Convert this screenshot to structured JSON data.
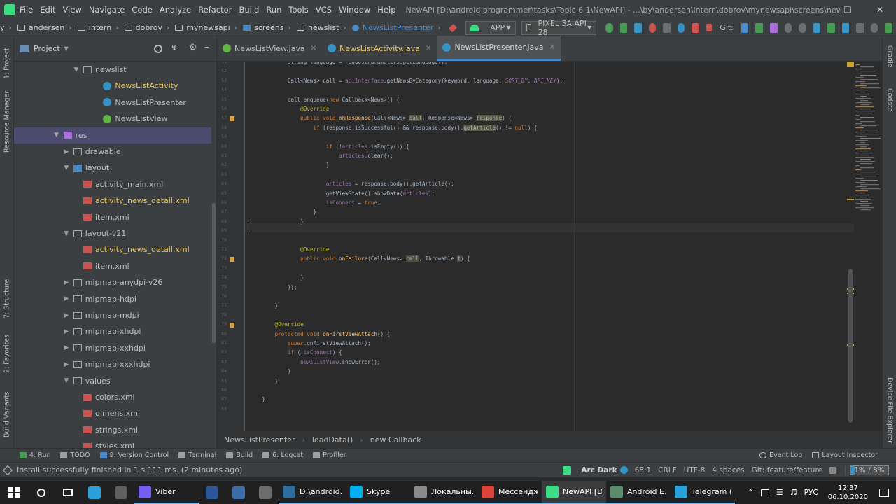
{
  "menubar": {
    "menus": [
      "File",
      "Edit",
      "View",
      "Navigate",
      "Code",
      "Analyze",
      "Refactor",
      "Build",
      "Run",
      "Tools",
      "VCS",
      "Window",
      "Help"
    ],
    "title": "NewAPI [D:\\android programmer\\tasks\\Topic 6 1\\NewAPI] - ...\\by\\andersen\\intern\\dobrov\\mynewsapi\\screens\\newslist\\NewsListPresenter.java [app]"
  },
  "navbar": {
    "crumbs": [
      "y",
      "andersen",
      "intern",
      "dobrov",
      "mynewsapi",
      "screens",
      "newslist",
      "NewsListPresenter"
    ],
    "run_config": "APP",
    "device": "PIXEL 3A API 28",
    "git_label": "Git:"
  },
  "left_strip": {
    "tabs": [
      "1: Project",
      "Resource Manager",
      "7: Structure",
      "2: Favorites",
      "Build Variants"
    ]
  },
  "right_strip": {
    "tabs": [
      "Gradle",
      "Codota",
      "Device File Explorer"
    ]
  },
  "project_panel": {
    "title": "Project",
    "rows": [
      {
        "label": "newslist",
        "indent": 5,
        "chev": "down",
        "icon": "folder"
      },
      {
        "label": "NewsListActivity",
        "indent": 7,
        "chev": "",
        "icon": "class",
        "modified": true
      },
      {
        "label": "NewsListPresenter",
        "indent": 7,
        "chev": "",
        "icon": "class"
      },
      {
        "label": "NewsListView",
        "indent": 7,
        "chev": "",
        "icon": "interface"
      },
      {
        "label": "res",
        "indent": 3,
        "chev": "down",
        "icon": "resfolder",
        "selected": true
      },
      {
        "label": "drawable",
        "indent": 4,
        "chev": "right",
        "icon": "folder"
      },
      {
        "label": "layout",
        "indent": 4,
        "chev": "down",
        "icon": "folder-blue"
      },
      {
        "label": "activity_main.xml",
        "indent": 5,
        "chev": "",
        "icon": "xml"
      },
      {
        "label": "activity_news_detail.xml",
        "indent": 5,
        "chev": "",
        "icon": "xml",
        "modified": true
      },
      {
        "label": "item.xml",
        "indent": 5,
        "chev": "",
        "icon": "xml"
      },
      {
        "label": "layout-v21",
        "indent": 4,
        "chev": "down",
        "icon": "folder"
      },
      {
        "label": "activity_news_detail.xml",
        "indent": 5,
        "chev": "",
        "icon": "xml",
        "modified": true
      },
      {
        "label": "item.xml",
        "indent": 5,
        "chev": "",
        "icon": "xml"
      },
      {
        "label": "mipmap-anydpi-v26",
        "indent": 4,
        "chev": "right",
        "icon": "folder"
      },
      {
        "label": "mipmap-hdpi",
        "indent": 4,
        "chev": "right",
        "icon": "folder"
      },
      {
        "label": "mipmap-mdpi",
        "indent": 4,
        "chev": "right",
        "icon": "folder"
      },
      {
        "label": "mipmap-xhdpi",
        "indent": 4,
        "chev": "right",
        "icon": "folder"
      },
      {
        "label": "mipmap-xxhdpi",
        "indent": 4,
        "chev": "right",
        "icon": "folder"
      },
      {
        "label": "mipmap-xxxhdpi",
        "indent": 4,
        "chev": "right",
        "icon": "folder"
      },
      {
        "label": "values",
        "indent": 4,
        "chev": "down",
        "icon": "folder"
      },
      {
        "label": "colors.xml",
        "indent": 5,
        "chev": "",
        "icon": "xml"
      },
      {
        "label": "dimens.xml",
        "indent": 5,
        "chev": "",
        "icon": "xml"
      },
      {
        "label": "strings.xml",
        "indent": 5,
        "chev": "",
        "icon": "xml"
      },
      {
        "label": "styles.xml",
        "indent": 5,
        "chev": "",
        "icon": "xml"
      }
    ]
  },
  "editor_tabs": [
    {
      "label": "NewsListView.java",
      "icon": "interface",
      "active": false,
      "modified": false
    },
    {
      "label": "NewsListActivity.java",
      "icon": "class",
      "active": false,
      "modified": true
    },
    {
      "label": "NewsListPresenter.java",
      "icon": "class",
      "active": true,
      "modified": false
    }
  ],
  "editor": {
    "lines": [
      {
        "n": "51",
        "html": "            String language = requestParameters.getLanguage();"
      },
      {
        "n": "52",
        "html": ""
      },
      {
        "n": "53",
        "html": "            Call&lt;News&gt; call = <span class=\"fld\">apiInterface</span>.getNewsByCategory(keyword, language, <span class=\"it\">SORT_BY</span>, <span class=\"it\">API_KEY</span>);"
      },
      {
        "n": "54",
        "html": ""
      },
      {
        "n": "55",
        "html": "            call.enqueue(<span class=\"kw\">new</span> Callback&lt;News&gt;() {"
      },
      {
        "n": "56",
        "html": "                <span class=\"ann\">@Override</span>"
      },
      {
        "n": "57",
        "html": "                <span class=\"kw\">public void</span> <span class=\"fn\">onResponse</span>(Call&lt;News&gt; <span class=\"hl\">call</span>, Response&lt;News&gt; <span class=\"hl\">response</span>) {"
      },
      {
        "n": "58",
        "html": "                    <span class=\"kw\">if</span> (response.isSuccessful() &amp;&amp; response.body().<span class=\"hl\">getArticle</span>() != <span class=\"kw\">null</span>) {"
      },
      {
        "n": "59",
        "html": ""
      },
      {
        "n": "60",
        "html": "                        <span class=\"kw\">if</span> (!<span class=\"fld\">articles</span>.isEmpty()) {"
      },
      {
        "n": "61",
        "html": "                            <span class=\"fld\">articles</span>.clear();"
      },
      {
        "n": "62",
        "html": "                        }"
      },
      {
        "n": "63",
        "html": ""
      },
      {
        "n": "64",
        "html": "                        <span class=\"fld\">articles</span> = response.body().getArticle();"
      },
      {
        "n": "65",
        "html": "                        getViewState().showData(<span class=\"fld\">articles</span>);"
      },
      {
        "n": "66",
        "html": "                        <span class=\"fld\">isConnect</span> = <span class=\"kw\">true</span>;"
      },
      {
        "n": "67",
        "html": "                    }"
      },
      {
        "n": "68",
        "html": "                }"
      },
      {
        "n": "69",
        "html": ""
      },
      {
        "n": "70",
        "html": ""
      },
      {
        "n": "71",
        "html": "                <span class=\"ann\">@Override</span>"
      },
      {
        "n": "72",
        "html": "                <span class=\"kw\">public void</span> <span class=\"fn\">onFailure</span>(Call&lt;News&gt; <span class=\"hl\">call</span>, Throwable <span class=\"hl\">t</span>) {"
      },
      {
        "n": "73",
        "html": ""
      },
      {
        "n": "74",
        "html": "                }"
      },
      {
        "n": "75",
        "html": "            });"
      },
      {
        "n": "76",
        "html": ""
      },
      {
        "n": "77",
        "html": "        }"
      },
      {
        "n": "78",
        "html": ""
      },
      {
        "n": "79",
        "html": "        <span class=\"ann\">@Override</span>"
      },
      {
        "n": "80",
        "html": "        <span class=\"kw\">protected void</span> <span class=\"fn\">onFirstViewAttach</span>() {"
      },
      {
        "n": "81",
        "html": "            <span class=\"kw\">super</span>.onFirstViewAttach();"
      },
      {
        "n": "82",
        "html": "            <span class=\"kw\">if</span> (!<span class=\"fld\">isConnect</span>) {"
      },
      {
        "n": "83",
        "html": "                <span class=\"fld\">newsListView</span>.showError();"
      },
      {
        "n": "84",
        "html": "            }"
      },
      {
        "n": "85",
        "html": "        }"
      },
      {
        "n": "86",
        "html": ""
      },
      {
        "n": "87",
        "html": "    }"
      },
      {
        "n": "88",
        "html": ""
      }
    ]
  },
  "breadcrumb": [
    "NewsListPresenter",
    "loadData()",
    "new Callback"
  ],
  "tool_windows_left": [
    {
      "label": "4: Run",
      "color": "#499c54"
    },
    {
      "label": "TODO",
      "color": "#a0a0a0"
    },
    {
      "label": "9: Version Control",
      "color": "#4a88c7"
    },
    {
      "label": "Terminal",
      "color": "#a0a0a0"
    },
    {
      "label": "Build",
      "color": "#a0a0a0"
    },
    {
      "label": "6: Logcat",
      "color": "#a0a0a0"
    },
    {
      "label": "Profiler",
      "color": "#a0a0a0"
    }
  ],
  "tool_windows_right": [
    "Event Log",
    "Layout Inspector"
  ],
  "status": {
    "message": "Install successfully finished in 1 s 111 ms. (2 minutes ago)",
    "theme": "Arc Dark",
    "position": "68:1",
    "line_sep": "CRLF",
    "encoding": "UTF-8",
    "indent": "4 spaces",
    "git_branch": "Git: feature/feature",
    "memory": "1% / 8%"
  },
  "taskbar": {
    "apps": [
      {
        "label": "",
        "color": "#2aa1da"
      },
      {
        "label": "",
        "color": "#5f5f5f"
      },
      {
        "label": "Viber",
        "color": "#7360f2",
        "state": "open"
      },
      {
        "label": "",
        "color": "#2b579a"
      },
      {
        "label": "",
        "color": "#3b6ea8"
      },
      {
        "label": "",
        "color": "#6c6c6c"
      },
      {
        "label": "D:\\android...",
        "color": "#2f6d9a",
        "state": "open"
      },
      {
        "label": "Skype",
        "color": "#00aff0",
        "state": "open"
      },
      {
        "label": "Локальны...",
        "color": "#8a8a8a",
        "state": "open"
      },
      {
        "label": "Мессендж...",
        "color": "#db4437",
        "state": "open"
      },
      {
        "label": "NewAPI [D...",
        "color": "#3ddc84",
        "state": "active"
      },
      {
        "label": "Android E...",
        "color": "#5c8a6c",
        "state": "open"
      },
      {
        "label": "Telegram (...",
        "color": "#2aa1da",
        "state": "open"
      }
    ],
    "lang": "РУС",
    "time": "12:37",
    "date": "06.10.2020"
  }
}
